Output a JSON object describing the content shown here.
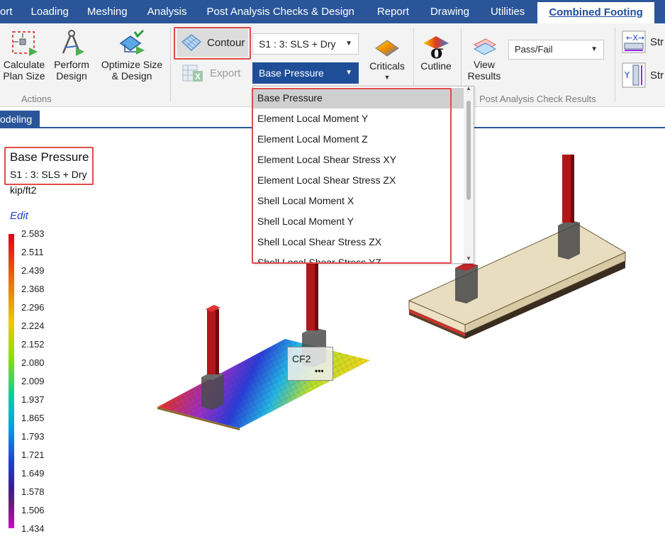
{
  "menubar": {
    "items": [
      "ort",
      "Loading",
      "Meshing",
      "Analysis",
      "Post Analysis Checks & Design",
      "Report",
      "Drawing",
      "Utilities"
    ],
    "active": "Combined Footing"
  },
  "ribbon": {
    "calc_plan_size": "Calculate Plan Size",
    "perform_design": "Perform Design",
    "optimize_size": "Optimize Size & Design",
    "actions_label": "Actions",
    "contour": "Contour",
    "export": "Export",
    "load_combo": "S1 : 3: SLS + Dry",
    "result_type": "Base Pressure",
    "criticals": "Criticals",
    "cutline": "Cutline",
    "view_results": "View Results",
    "passfail": "Pass/Fail",
    "post_label": "Post Analysis Check Results",
    "str1": "Str",
    "str2": "Str"
  },
  "view_tab": "odeling",
  "results": {
    "title": "Base Pressure",
    "combo": "S1 : 3: SLS + Dry",
    "unit": "kip/ft2",
    "edit": "Edit"
  },
  "legend": [
    "2.583",
    "2.511",
    "2.439",
    "2.368",
    "2.296",
    "2.224",
    "2.152",
    "2.080",
    "2.009",
    "1.937",
    "1.865",
    "1.793",
    "1.721",
    "1.649",
    "1.578",
    "1.506",
    "1.434"
  ],
  "dropdown": {
    "items": [
      "Base Pressure",
      "Element Local Moment Y",
      "Element Local Moment Z",
      "Element Local Shear Stress XY",
      "Element Local Shear Stress ZX",
      "Shell Local Moment X",
      "Shell Local Moment Y",
      "Shell Local Shear Stress ZX",
      "Shell Local Shear Stress YZ"
    ],
    "selected": 0
  },
  "model": {
    "label": "CF2",
    "more": "•••"
  },
  "colors": {
    "menubar": "#2a5699",
    "selection": "#1f4e99",
    "highlight": "#e04b4b"
  }
}
